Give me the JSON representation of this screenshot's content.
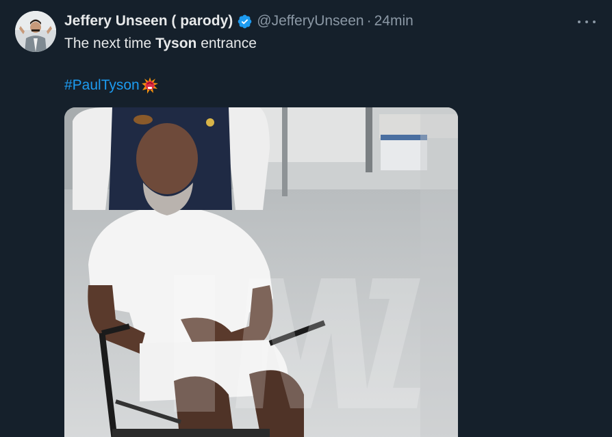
{
  "tweet": {
    "display_name": "Jeffery Unseen ( parody)",
    "handle": "@JefferyUnseen",
    "separator": "·",
    "time": "24min",
    "text_part1": "The next time ",
    "text_bold": "Tyson",
    "text_part2": " entrance",
    "hashtag": "#PaulTyson",
    "hashtag_emoji": "boxing-glove-impact-emoji",
    "verified_icon": "verified-badge-icon",
    "more_icon": "more-options-icon"
  },
  "media": {
    "watermark": "TMZ",
    "description_icon": "photo-image"
  },
  "colors": {
    "background": "#15202b",
    "primary_text": "#e7e9ea",
    "secondary_text": "#8b98a5",
    "link": "#1d9bf0",
    "verified": "#1d9bf0"
  }
}
